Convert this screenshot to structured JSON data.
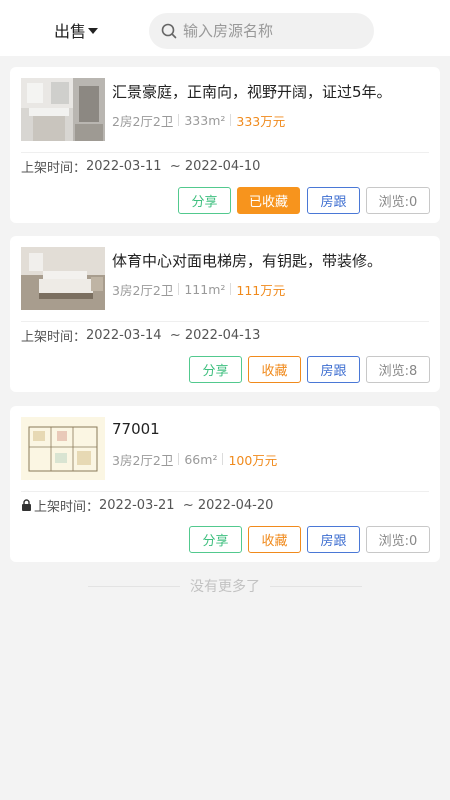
{
  "header": {
    "type_label": "出售",
    "search_placeholder": "输入房源名称"
  },
  "listings": [
    {
      "title": "汇景豪庭，正南向，视野开阔，证过5年。",
      "layout": "2房2厅2卫",
      "area": "333m²",
      "price": "333万元",
      "date_label": "上架时间：",
      "date_range": "2022-03-11  ~ 2022-04-10",
      "locked": false,
      "share_label": "分享",
      "fav_label": "已收藏",
      "fav_active": true,
      "follow_label": "房跟",
      "views_label": "浏览:0",
      "thumb_icon": "bathroom-photo"
    },
    {
      "title": "体育中心对面电梯房，有钥匙，带装修。",
      "layout": "3房2厅2卫",
      "area": "111m²",
      "price": "111万元",
      "date_label": "上架时间：",
      "date_range": "2022-03-14  ~ 2022-04-13",
      "locked": false,
      "share_label": "分享",
      "fav_label": "收藏",
      "fav_active": false,
      "follow_label": "房跟",
      "views_label": "浏览:8",
      "thumb_icon": "bedroom-photo"
    },
    {
      "title": "77001",
      "layout": "3房2厅2卫",
      "area": "66m²",
      "price": "100万元",
      "date_label": "上架时间：",
      "date_range": "2022-03-21  ~ 2022-04-20",
      "locked": true,
      "share_label": "分享",
      "fav_label": "收藏",
      "fav_active": false,
      "follow_label": "房跟",
      "views_label": "浏览:0",
      "thumb_icon": "floorplan-image"
    }
  ],
  "footer": {
    "no_more": "没有更多了"
  },
  "colors": {
    "accent_orange": "#f7941d",
    "share_green": "#3fbf7f",
    "follow_blue": "#3f6fd1",
    "price_orange": "#f08a1c"
  }
}
